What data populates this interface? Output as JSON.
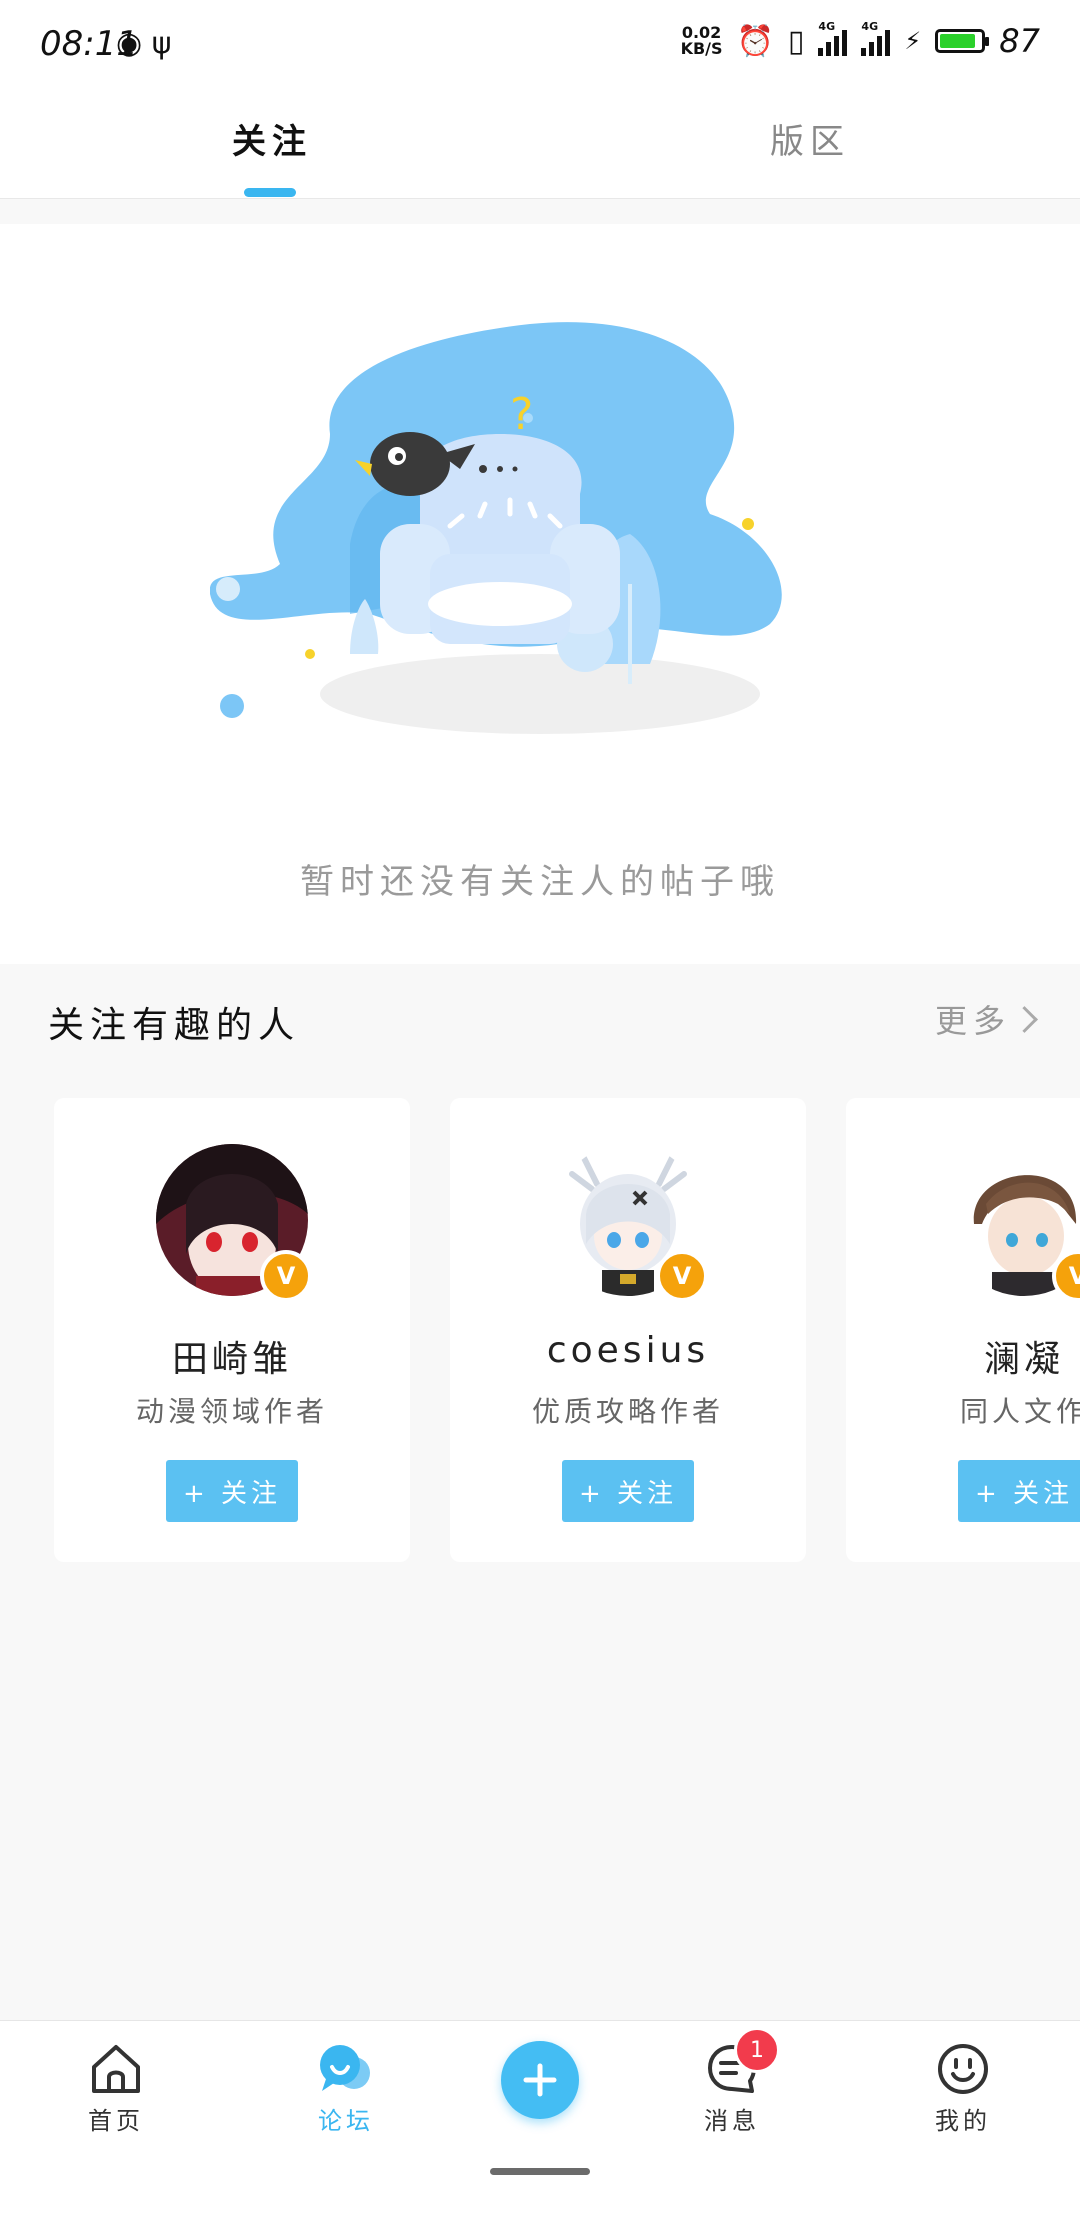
{
  "status_bar": {
    "time": "08:11",
    "net_speed_value": "0.02",
    "net_speed_unit": "KB/S",
    "network_label_1": "4G",
    "network_label_2": "4G",
    "battery_percent": "87",
    "battery_level": 0.87,
    "icons": [
      "hotspot-icon",
      "usb-icon",
      "alarm-icon",
      "vibrate-icon",
      "signal-icon",
      "charging-icon",
      "battery-icon"
    ]
  },
  "tabs": [
    {
      "label": "关注",
      "active": true
    },
    {
      "label": "版区",
      "active": false
    }
  ],
  "empty_state": {
    "message": "暂时还没有关注人的帖子哦"
  },
  "recommend": {
    "title": "关注有趣的人",
    "more_label": "更多",
    "users": [
      {
        "name": "田崎雏",
        "desc": "动漫领域作者",
        "button": "+ 关注",
        "verified_badge": "V"
      },
      {
        "name": "coesius",
        "desc": "优质攻略作者",
        "button": "+ 关注",
        "verified_badge": "V"
      },
      {
        "name": "澜凝",
        "desc": "同人文作",
        "button": "+ 关注",
        "verified_badge": "V"
      }
    ]
  },
  "bottom_nav": {
    "items": [
      {
        "label": "首页",
        "icon": "home-icon"
      },
      {
        "label": "论坛",
        "icon": "forum-icon",
        "active": true
      },
      {
        "label": "",
        "icon": "plus-icon"
      },
      {
        "label": "消息",
        "icon": "message-icon",
        "badge": "1"
      },
      {
        "label": "我的",
        "icon": "profile-icon"
      }
    ]
  },
  "colors": {
    "accent": "#3ab6f0",
    "follow_button": "#5bc1f2",
    "badge": "#f5a20b",
    "notification": "#f23b4c"
  }
}
